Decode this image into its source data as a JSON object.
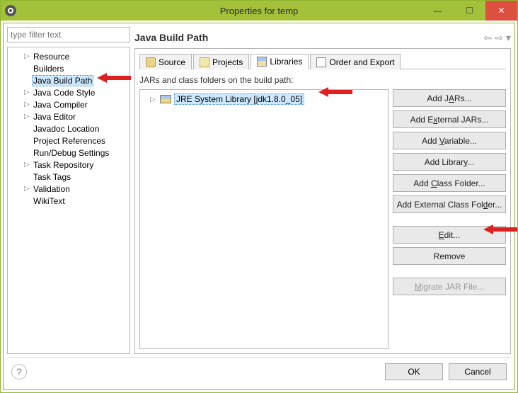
{
  "window": {
    "title": "Properties for temp"
  },
  "filter": {
    "placeholder": "type filter text"
  },
  "tree": {
    "items": [
      {
        "label": "Resource",
        "expandable": true
      },
      {
        "label": "Builders",
        "expandable": false
      },
      {
        "label": "Java Build Path",
        "expandable": false,
        "selected": true
      },
      {
        "label": "Java Code Style",
        "expandable": true
      },
      {
        "label": "Java Compiler",
        "expandable": true
      },
      {
        "label": "Java Editor",
        "expandable": true
      },
      {
        "label": "Javadoc Location",
        "expandable": false
      },
      {
        "label": "Project References",
        "expandable": false
      },
      {
        "label": "Run/Debug Settings",
        "expandable": false
      },
      {
        "label": "Task Repository",
        "expandable": true
      },
      {
        "label": "Task Tags",
        "expandable": false
      },
      {
        "label": "Validation",
        "expandable": true
      },
      {
        "label": "WikiText",
        "expandable": false
      }
    ]
  },
  "page": {
    "title": "Java Build Path",
    "tabs": {
      "source": "Source",
      "projects": "Projects",
      "libraries": "Libraries",
      "order": "Order and Export"
    },
    "description": "JARs and class folders on the build path:",
    "library_item": "JRE System Library [jdk1.8.0_05]"
  },
  "buttons": {
    "add_jars": "Add JARs...",
    "add_external_jars": "Add External JARs...",
    "add_variable": "Add Variable...",
    "add_library": "Add Library...",
    "add_class_folder": "Add Class Folder...",
    "add_external_class_folder": "Add External Class Folder...",
    "edit": "Edit...",
    "remove": "Remove",
    "migrate": "Migrate JAR File...",
    "ok": "OK",
    "cancel": "Cancel"
  }
}
